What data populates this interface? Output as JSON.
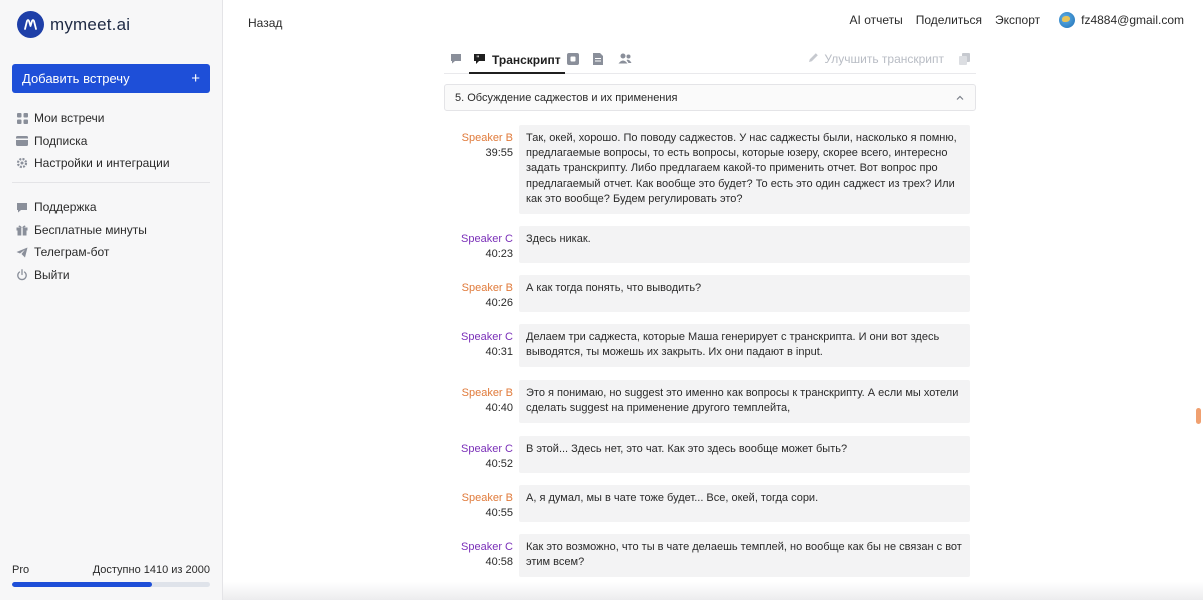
{
  "app": {
    "name": "mymeet.ai"
  },
  "sidebar": {
    "add_meeting": "Добавить встречу",
    "nav_primary": [
      {
        "label": "Мои встречи",
        "icon": "grid-icon"
      },
      {
        "label": "Подписка",
        "icon": "card-icon"
      },
      {
        "label": "Настройки и интеграции",
        "icon": "gear-icon"
      }
    ],
    "nav_secondary": [
      {
        "label": "Поддержка",
        "icon": "chat-icon"
      },
      {
        "label": "Бесплатные минуты",
        "icon": "gift-icon"
      },
      {
        "label": "Телеграм-бот",
        "icon": "send-icon"
      },
      {
        "label": "Выйти",
        "icon": "power-icon"
      }
    ],
    "plan": {
      "name": "Pro",
      "available": "Доступно 1410 из 2000",
      "used_fraction": 0.705
    }
  },
  "header": {
    "back": "Назад",
    "ai_reports": "AI отчеты",
    "share": "Поделиться",
    "export": "Экспорт",
    "user_email": "fz4884@gmail.com"
  },
  "tabs": {
    "active": "Транскрипт",
    "improve": "Улучшить транскрипт"
  },
  "section": {
    "title": "5. Обсуждение саджестов и их применения"
  },
  "transcript": [
    {
      "speaker": "Speaker B",
      "time": "39:55",
      "text": "Так, окей, хорошо. По поводу саджестов. У нас саджесты были, насколько я помню, предлагаемые вопросы, то есть вопросы, которые юзеру, скорее всего, интересно задать транскрипту. Либо предлагаем какой-то применить отчет. Вот вопрос про предлагаемый отчет. Как вообще это будет? То есть это один саджест из трех? Или как это вообще? Будем регулировать это?"
    },
    {
      "speaker": "Speaker C",
      "time": "40:23",
      "text": "Здесь никак."
    },
    {
      "speaker": "Speaker B",
      "time": "40:26",
      "text": "А как тогда понять, что выводить?"
    },
    {
      "speaker": "Speaker C",
      "time": "40:31",
      "text": "Делаем три саджеста, которые Маша генерирует с транскрипта. И они вот здесь выводятся, ты можешь их закрыть. Их они падают в input."
    },
    {
      "speaker": "Speaker B",
      "time": "40:40",
      "text": "Это я понимаю, но suggest это именно как вопросы к транскрипту. А если мы хотели сделать suggest на применение другого темплейта,"
    },
    {
      "speaker": "Speaker C",
      "time": "40:52",
      "text": "В этой... Здесь нет, это чат. Как это здесь вообще может быть?"
    },
    {
      "speaker": "Speaker B",
      "time": "40:55",
      "text": "А, я думал, мы в чате тоже будет... Все, окей, тогда сори."
    },
    {
      "speaker": "Speaker C",
      "time": "40:58",
      "text": "Как это возможно, что ты в чате делаешь темплей, но вообще как бы не связан с вот этим всем?"
    }
  ],
  "colors": {
    "accent": "#1e4fd8",
    "speaker_b": "#e07a3a",
    "speaker_c": "#7a2fb8"
  }
}
